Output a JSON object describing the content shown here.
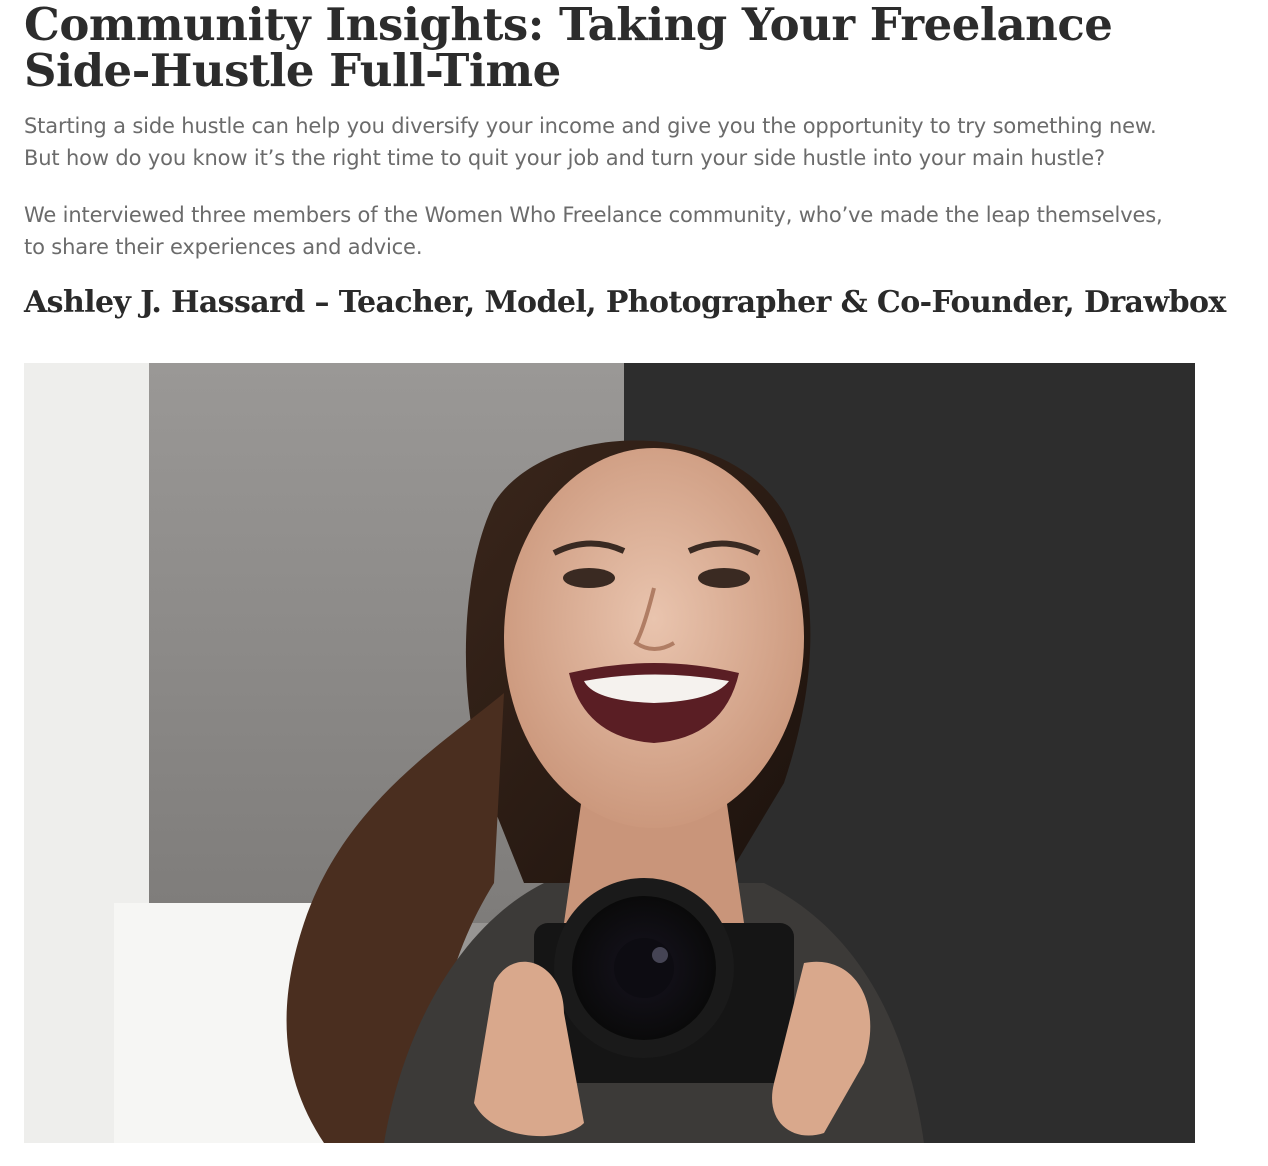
{
  "article": {
    "title": "Community Insights: Taking Your Freelance Side-Hustle Full-Time",
    "intro_paragraph_1": "Starting a side hustle can help you diversify your income and give you the opportunity to try something new. But how do you know it’s the right time to quit your job and turn your side hustle into your main hustle?",
    "intro_paragraph_2": "We interviewed three members of the Women Who Freelance community, who’ve made the leap themselves, to share their experiences and advice.",
    "section_heading": "Ashley J. Hassard – Teacher, Model, Photographer & Co-Founder, Drawbox"
  },
  "colors": {
    "title_text": "#2c2c2c",
    "body_text": "#6b6b6b",
    "heading_text": "#2a2a2a",
    "background": "#ffffff",
    "photo_backdrop": "#2b2b2b"
  }
}
